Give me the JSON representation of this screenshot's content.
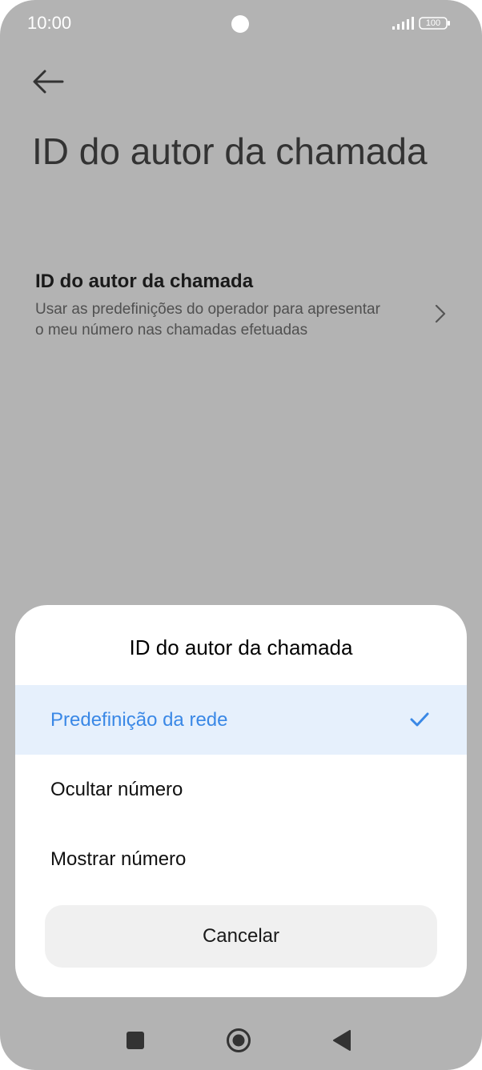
{
  "status_bar": {
    "time": "10:00",
    "battery": "100",
    "icons": [
      "signal-icon",
      "battery-icon"
    ]
  },
  "header": {
    "back_icon": "arrow-left-icon",
    "title": "ID do autor da chamada"
  },
  "setting": {
    "title": "ID do autor da chamada",
    "description": "Usar as predefinições do operador para apresentar o meu número nas chamadas efetuadas",
    "icon": "chevron-right-icon"
  },
  "dialog": {
    "title": "ID do autor da chamada",
    "options": [
      {
        "label": "Predefinição da rede",
        "selected": true
      },
      {
        "label": "Ocultar número",
        "selected": false
      },
      {
        "label": "Mostrar número",
        "selected": false
      }
    ],
    "cancel_label": "Cancelar"
  },
  "nav_bar": {
    "icons": [
      "recent-apps-icon",
      "home-icon",
      "back-icon"
    ]
  },
  "colors": {
    "accent": "#3a88e6",
    "selected_row": "#e6f0fc",
    "scrim": "#b3b3b3",
    "sheet": "#ffffff"
  }
}
